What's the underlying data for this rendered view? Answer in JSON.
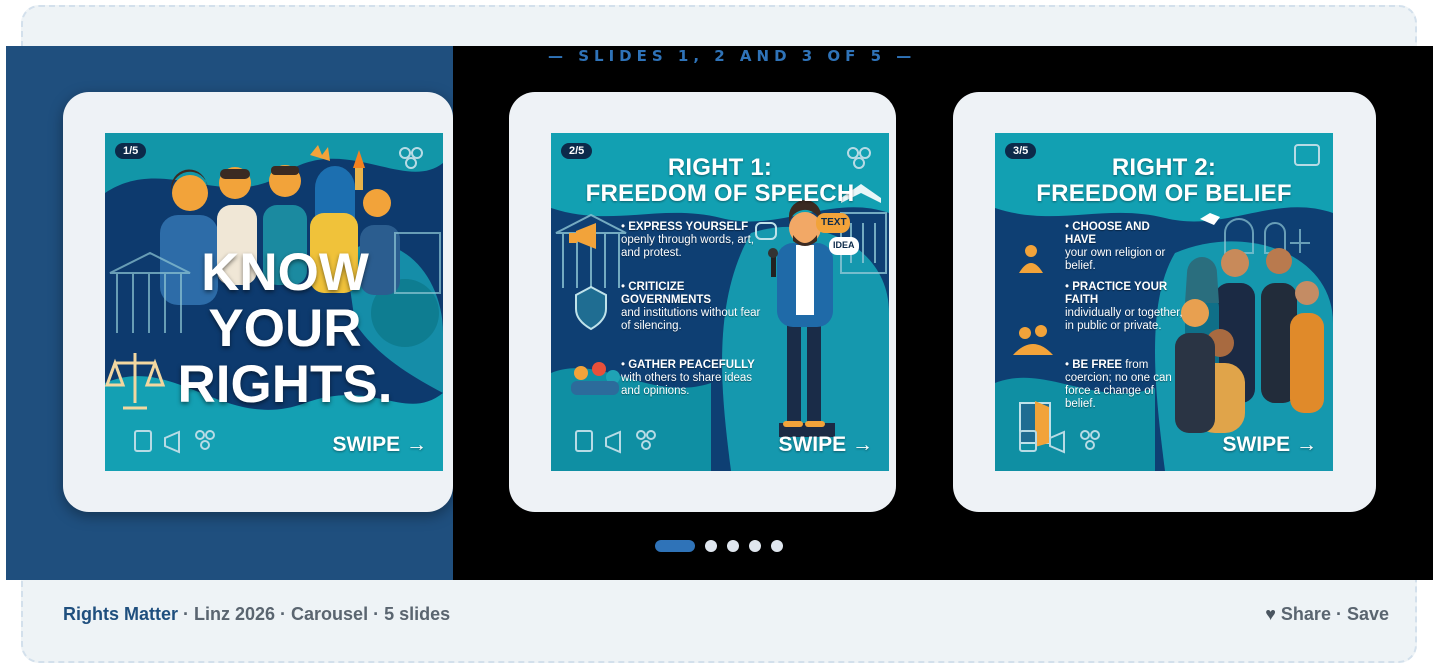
{
  "header": {
    "slides_label": "— SLIDES 1, 2 AND 3 OF 5 —"
  },
  "slides": [
    {
      "counter": "1/5",
      "title_lines": [
        "KNOW",
        "YOUR",
        "RIGHTS."
      ],
      "swipe": "SWIPE →"
    },
    {
      "counter": "2/5",
      "title_lines": [
        "RIGHT 1:",
        "FREEDOM OF SPEECH"
      ],
      "bubbles": [
        "TEXT",
        "IDEA"
      ],
      "items": [
        {
          "bold": "EXPRESS YOURSELF",
          "text": "openly through words, art, and protest."
        },
        {
          "bold": "CRITICIZE GOVERNMENTS",
          "text": "and institutions without fear of silencing."
        },
        {
          "bold": "GATHER PEACEFULLY",
          "text": "with others to share ideas and opinions."
        }
      ],
      "swipe": "SWIPE →"
    },
    {
      "counter": "3/5",
      "title_lines": [
        "RIGHT 2:",
        "FREEDOM OF BELIEF"
      ],
      "items": [
        {
          "bold": "CHOOSE AND HAVE",
          "text": "your own religion or belief."
        },
        {
          "bold": "PRACTICE YOUR FAITH",
          "text": "individually or together, in public or private."
        },
        {
          "bold": "BE FREE",
          "text": "from coercion; no one can force a change of belief."
        }
      ],
      "swipe": "SWIPE →"
    }
  ],
  "pagination": {
    "total": 5,
    "active": 1
  },
  "footer": {
    "brand": "Rights Matter",
    "meta": " · Linz 2026 · Carousel · 5 slides",
    "heart_icon": "heart-icon",
    "share": "Share",
    "separator": " · ",
    "save": "Save"
  },
  "colors": {
    "navy": "#1f4f7e",
    "accent": "#2f73b8",
    "teal": "#1fa3b5"
  }
}
